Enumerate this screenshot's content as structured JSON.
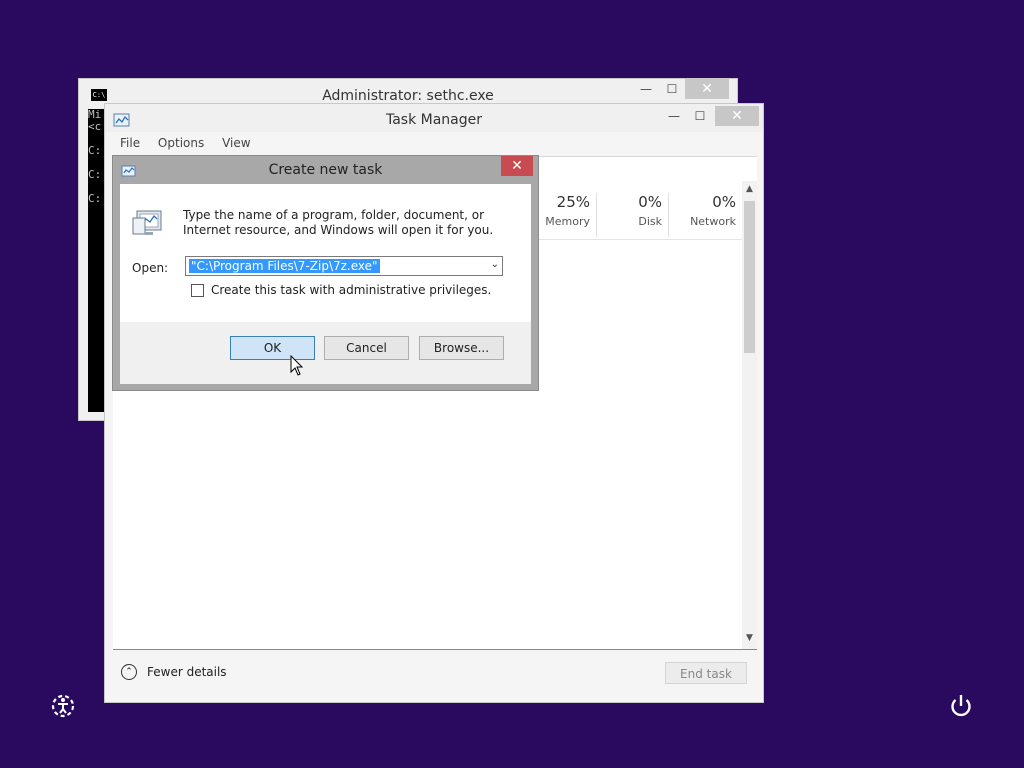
{
  "cmd_window": {
    "title": "Administrator: sethc.exe",
    "icon_text": "C:\\",
    "lines": [
      "Mi",
      "<c",
      "",
      "C:",
      "",
      "C:",
      "",
      "C:"
    ],
    "minimize": "—",
    "maximize": "☐",
    "close": "✕"
  },
  "task_manager": {
    "title": "Task Manager",
    "menu": [
      "File",
      "Options",
      "View"
    ],
    "performance": [
      {
        "value": "25%",
        "label": "Memory"
      },
      {
        "value": "0%",
        "label": "Disk"
      },
      {
        "value": "0%",
        "label": "Network"
      }
    ],
    "fewer_details": "Fewer details",
    "end_task": "End task",
    "minimize": "—",
    "maximize": "☐",
    "close": "✕",
    "scroll_up": "▲",
    "scroll_down": "▼"
  },
  "dialog": {
    "title": "Create new task",
    "close": "✕",
    "description": "Type the name of a program, folder, document, or Internet resource, and Windows will open it for you.",
    "open_label": "Open:",
    "open_value": "\"C:\\Program Files\\7-Zip\\7z.exe\"",
    "admin_checkbox_label": "Create this task with administrative privileges.",
    "admin_checked": false,
    "ok": "OK",
    "cancel": "Cancel",
    "browse": "Browse..."
  },
  "colors": {
    "desktop": "#2a0a5e",
    "close_red": "#c74b50",
    "selection": "#3399ff"
  }
}
